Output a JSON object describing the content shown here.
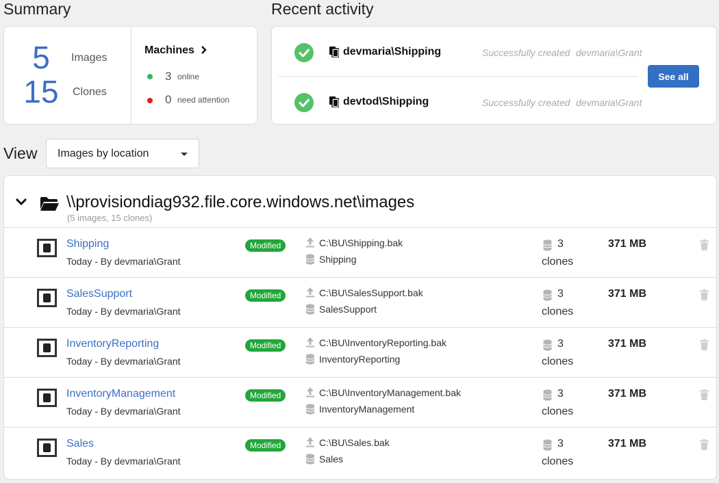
{
  "summary": {
    "title": "Summary",
    "images_count": "5",
    "images_label": "Images",
    "clones_count": "15",
    "clones_label": "Clones",
    "machines_title": "Machines",
    "online_count": "3",
    "online_label": "online",
    "attention_count": "0",
    "attention_label": "need attention",
    "online_color": "#3cb55a",
    "attention_color": "#e02020"
  },
  "activity": {
    "title": "Recent activity",
    "items": [
      {
        "name": "devmaria\\Shipping",
        "status": "Successfully created",
        "user": "devmaria\\Grant"
      },
      {
        "name": "devtod\\Shipping",
        "status": "Successfully created",
        "user": "devmaria\\Grant"
      }
    ],
    "see_all_label": "See all"
  },
  "view": {
    "label": "View",
    "selected": "Images by location"
  },
  "location": {
    "path": "\\\\provisiondiag932.file.core.windows.net\\images",
    "subtitle": "(5 images, 15 clones)",
    "images": [
      {
        "name": "Shipping",
        "meta": "Today - By devmaria\\Grant",
        "badge": "Modified",
        "source_path": "C:\\BU\\Shipping.bak",
        "source_db": "Shipping",
        "clones": "3",
        "clones_label": "clones",
        "size": "371 MB"
      },
      {
        "name": "SalesSupport",
        "meta": "Today - By devmaria\\Grant",
        "badge": "Modified",
        "source_path": "C:\\BU\\SalesSupport.bak",
        "source_db": "SalesSupport",
        "clones": "3",
        "clones_label": "clones",
        "size": "371 MB"
      },
      {
        "name": "InventoryReporting",
        "meta": "Today - By devmaria\\Grant",
        "badge": "Modified",
        "source_path": "C:\\BU\\InventoryReporting.bak",
        "source_db": "InventoryReporting",
        "clones": "3",
        "clones_label": "clones",
        "size": "371 MB"
      },
      {
        "name": "InventoryManagement",
        "meta": "Today - By devmaria\\Grant",
        "badge": "Modified",
        "source_path": "C:\\BU\\InventoryManagement.bak",
        "source_db": "InventoryManagement",
        "clones": "3",
        "clones_label": "clones",
        "size": "371 MB"
      },
      {
        "name": "Sales",
        "meta": "Today - By devmaria\\Grant",
        "badge": "Modified",
        "source_path": "C:\\BU\\Sales.bak",
        "source_db": "Sales",
        "clones": "3",
        "clones_label": "clones",
        "size": "371 MB"
      }
    ]
  },
  "colors": {
    "accent": "#3170c3",
    "link": "#3a6fc4",
    "badge": "#22a63a",
    "success": "#55c26a"
  },
  "icons": {
    "activity_status": "check-circle-icon",
    "activity_db": "database-copy-icon",
    "machines_nav": "chevron-right-icon",
    "dropdown": "caret-down-icon",
    "location_toggle": "chevron-down-icon",
    "location": "folder-open-icon",
    "image": "image-icon",
    "source_file": "upload-arrow-icon",
    "source_db": "database-icon",
    "clones": "database-stack-icon",
    "delete": "trash-icon"
  }
}
